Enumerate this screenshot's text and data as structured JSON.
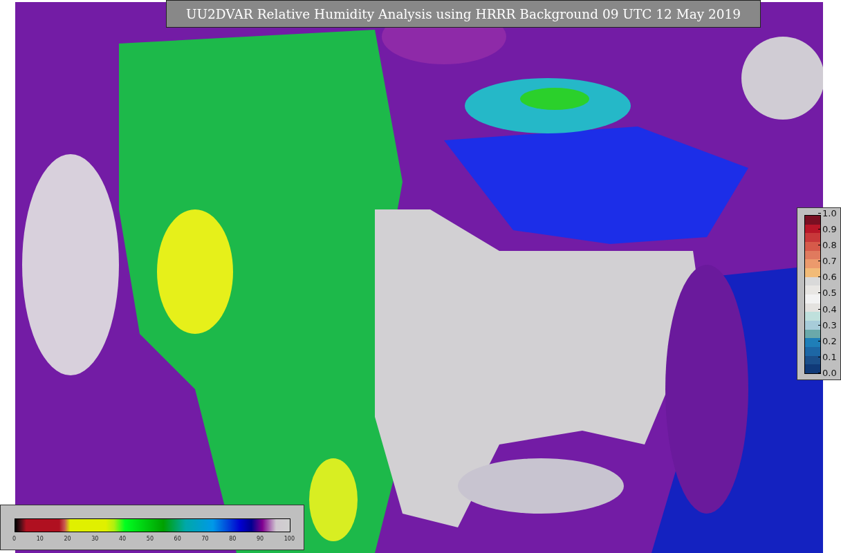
{
  "title": "UU2DVAR Relative Humidity Analysis using HRRR Background 09 UTC 12 May 2019",
  "humidity_colorbar": {
    "ticks": [
      "0",
      "10",
      "20",
      "30",
      "40",
      "50",
      "60",
      "70",
      "80",
      "90",
      "100"
    ]
  },
  "observation_colorbar": {
    "ticks": [
      "1.0",
      "0.9",
      "0.8",
      "0.7",
      "0.6",
      "0.5",
      "0.4",
      "0.3",
      "0.2",
      "0.1",
      "0.0"
    ]
  }
}
